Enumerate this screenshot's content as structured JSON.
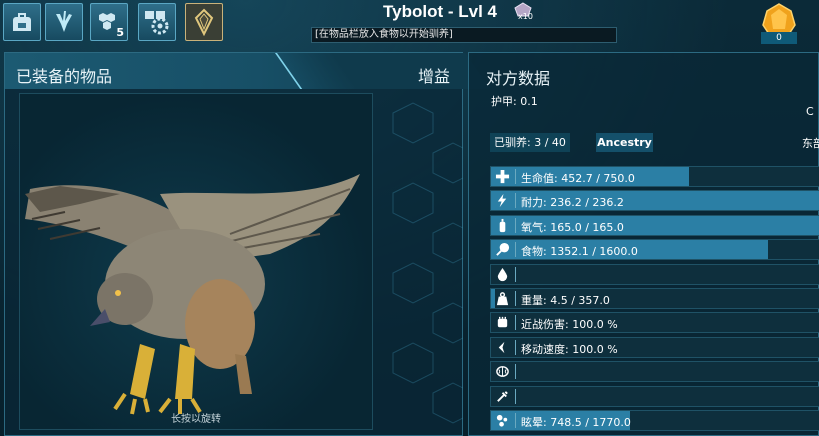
{
  "header": {
    "creature_name": "Tybolot - Lvl 4",
    "gem_count": "x10",
    "taming_hint": "[在物品栏放入食物以开始驯养]",
    "amber_count": "0",
    "tabs": [
      {
        "icon": "backpack-icon"
      },
      {
        "icon": "dino-footprint-icon"
      },
      {
        "icon": "engrams-icon",
        "badge": "5"
      },
      {
        "icon": "settings-gear-icon"
      },
      {
        "icon": "implant-crystal-icon"
      }
    ]
  },
  "left_panel": {
    "title": "已装备的物品",
    "buff_label": "增益",
    "rotate_hint": "长按以旋转"
  },
  "right_panel": {
    "title": "对方数据",
    "armor": "护甲: 0.1",
    "tamed": "已驯养: 3 / 40",
    "ancestry_label": "Ancestry",
    "clipped_right": "东部",
    "clipped_top": "C",
    "stats": [
      {
        "icon": "health-cross-icon",
        "label": "生命值: 452.7 / 750.0",
        "fill": 0.6036
      },
      {
        "icon": "stamina-bolt-icon",
        "label": "耐力: 236.2 / 236.2",
        "fill": 1.0
      },
      {
        "icon": "oxygen-tank-icon",
        "label": "氧气: 165.0 / 165.0",
        "fill": 1.0
      },
      {
        "icon": "food-drumstick-icon",
        "label": "食物: 1352.1 / 1600.0",
        "fill": 0.845
      },
      {
        "icon": "water-drop-icon",
        "label": "",
        "fill": 0
      },
      {
        "icon": "weight-icon",
        "label": "重量: 4.5 / 357.0",
        "fill": 0.0126
      },
      {
        "icon": "melee-fist-icon",
        "label": "近战伤害: 100.0 %",
        "fill": 0
      },
      {
        "icon": "movement-speed-icon",
        "label": "移动速度: 100.0 %",
        "fill": 0
      },
      {
        "icon": "fortitude-brain-icon",
        "label": "",
        "fill": 0
      },
      {
        "icon": "crafting-skill-icon",
        "label": "",
        "fill": 0
      },
      {
        "icon": "torpor-icon",
        "label": "眩晕: 748.5 / 1770.0",
        "fill": 0.4229
      }
    ]
  },
  "colors": {
    "bar_fill": "#2b7fa5",
    "bar_bg": "#0e2f3d",
    "panel_border": "#2c6a82",
    "accent": "#7fd2ea"
  }
}
